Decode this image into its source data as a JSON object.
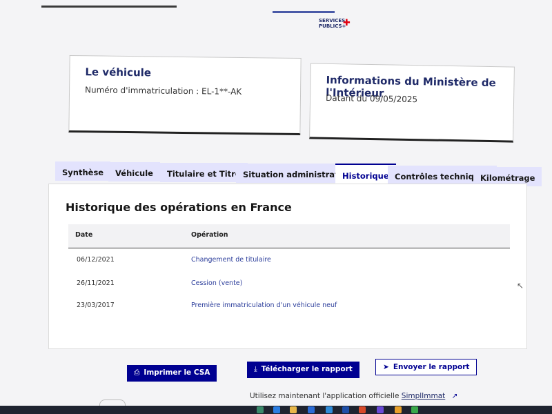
{
  "brand": {
    "logo_line1": "SERVICES",
    "logo_line2": "PUBLICS+"
  },
  "vehicle_card": {
    "title": "Le véhicule",
    "plate_text": "Numéro d'immatriculation : EL-1**-AK"
  },
  "ministry_card": {
    "title": "Informations du Ministère de l'Intérieur",
    "date_text": "Datant du 09/05/2025"
  },
  "tabs": [
    {
      "label": "Synthèse",
      "active": false
    },
    {
      "label": "Véhicule",
      "active": false
    },
    {
      "label": "Titulaire et Titre",
      "active": false
    },
    {
      "label": "Situation administrative",
      "active": false
    },
    {
      "label": "Historique",
      "active": true
    },
    {
      "label": "Contrôles techniques",
      "active": false
    },
    {
      "label": "Kilométrage",
      "active": false
    }
  ],
  "history": {
    "title": "Historique des opérations en France",
    "columns": {
      "date": "Date",
      "operation": "Opération"
    },
    "rows": [
      {
        "date": "06/12/2021",
        "operation": "Changement de titulaire"
      },
      {
        "date": "26/11/2021",
        "operation": "Cession (vente)"
      },
      {
        "date": "23/03/2017",
        "operation": "Première immatriculation d'un véhicule neuf"
      }
    ]
  },
  "actions": {
    "print": "Imprimer le CSA",
    "download": "Télécharger le rapport",
    "send": "Envoyer le rapport"
  },
  "footer": {
    "text": "Utilisez maintenant l'application officielle",
    "link": "SimplImmat"
  },
  "colors": {
    "primary": "#000091",
    "tab_bg": "#e3e3fd",
    "brand_dark": "#1f2a68"
  }
}
